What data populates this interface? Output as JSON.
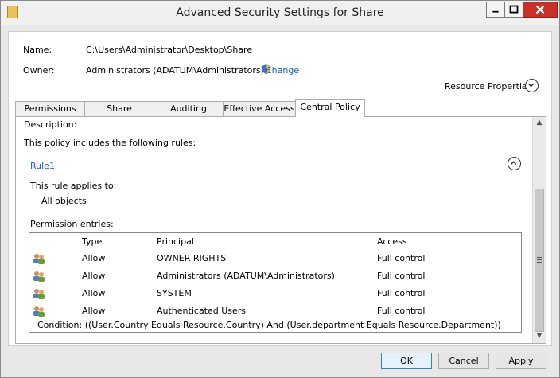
{
  "window": {
    "title": "Advanced Security Settings for Share"
  },
  "info": {
    "name_label": "Name:",
    "name_value": "C:\\Users\\Administrator\\Desktop\\Share",
    "owner_label": "Owner:",
    "owner_value": "Administrators (ADATUM\\Administrators)",
    "change_link": "Change",
    "resource_properties": "Resource Properties"
  },
  "tabs": [
    {
      "label": "Permissions"
    },
    {
      "label": "Share"
    },
    {
      "label": "Auditing"
    },
    {
      "label": "Effective Access"
    },
    {
      "label": "Central Policy"
    }
  ],
  "panel": {
    "description_label": "Description:",
    "policy_text": "This policy includes the following rules:",
    "rule_name": "Rule1",
    "applies_label": "This rule applies to:",
    "applies_value": "All objects",
    "permission_label": "Permission entries:"
  },
  "entries": {
    "headers": [
      "Type",
      "Principal",
      "Access"
    ],
    "rows": [
      {
        "type": "Allow",
        "principal": "OWNER RIGHTS",
        "access": "Full control"
      },
      {
        "type": "Allow",
        "principal": "Administrators (ADATUM\\Administrators)",
        "access": "Full control"
      },
      {
        "type": "Allow",
        "principal": "SYSTEM",
        "access": "Full control"
      },
      {
        "type": "Allow",
        "principal": "Authenticated Users",
        "access": "Full control"
      }
    ],
    "condition": "Condition:  ((User.Country Equals Resource.Country) And (User.department Equals Resource.Department))"
  },
  "buttons": {
    "ok": "OK",
    "cancel": "Cancel",
    "apply": "Apply"
  },
  "colors": {
    "link": "#1e5fae",
    "close_button": "#c7312a"
  }
}
